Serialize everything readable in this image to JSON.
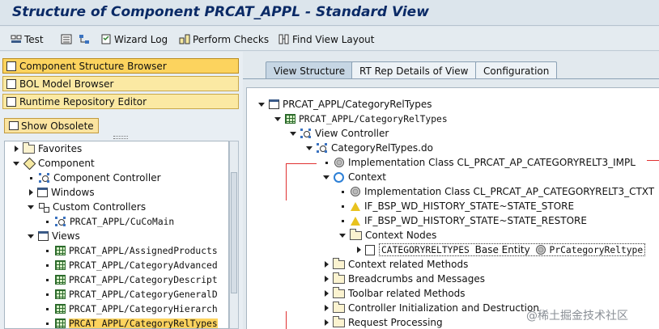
{
  "window": {
    "title": "Structure of Component PRCAT_APPL - Standard View"
  },
  "toolbar": {
    "test": "Test",
    "wizard_log": "Wizard Log",
    "perform_checks": "Perform Checks",
    "find_view_layout": "Find View Layout"
  },
  "nav": {
    "component_structure_browser": "Component Structure Browser",
    "bol_model_browser": "BOL Model Browser",
    "runtime_repository_editor": "Runtime Repository Editor",
    "show_obsolete": "Show Obsolete"
  },
  "left_tree": {
    "favorites": "Favorites",
    "component": "Component",
    "component_controller": "Component Controller",
    "windows": "Windows",
    "custom_controllers": "Custom Controllers",
    "cucomain": "PRCAT_APPL/CuCoMain",
    "views": "Views",
    "view_items": [
      "PRCAT_APPL/AssignedProducts",
      "PRCAT_APPL/CategoryAdvanced",
      "PRCAT_APPL/CategoryDescript",
      "PRCAT_APPL/CategoryGeneralD",
      "PRCAT_APPL/CategoryHierarch",
      "PRCAT_APPL/CategoryRelTypes"
    ]
  },
  "tabs": {
    "view_structure": "View Structure",
    "rt_rep_details": "RT Rep Details of View",
    "configuration": "Configuration"
  },
  "right_tree": {
    "root": "PRCAT_APPL/CategoryRelTypes",
    "view_node": "PRCAT_APPL/CategoryRelTypes",
    "view_controller": "View Controller",
    "do_file": "CategoryRelTypes.do",
    "impl_class": "Implementation Class CL_PRCAT_AP_CATEGORYRELT3_IMPL",
    "context": "Context",
    "ctx_impl_class": "Implementation Class CL_PRCAT_AP_CATEGORYRELT3_CTXT",
    "history_store": "IF_BSP_WD_HISTORY_STATE~STATE_STORE",
    "history_restore": "IF_BSP_WD_HISTORY_STATE~STATE_RESTORE",
    "context_nodes": "Context Nodes",
    "entity_name": "CATEGORYRELTYPES",
    "entity_kind": "Base Entity",
    "entity_type": "PrCategoryReltype",
    "context_methods": "Context related Methods",
    "breadcrumbs": "Breadcrumbs and Messages",
    "toolbar_methods": "Toolbar related Methods",
    "controller_init": "Controller Initialization and Destruction",
    "request_processing": "Request Processing"
  },
  "watermark": "@稀土掘金技术社区",
  "colors": {
    "title": "#0a2a66",
    "nav_active": "#fcd35e",
    "nav": "#fbe9a3",
    "annotation": "#e03131"
  }
}
